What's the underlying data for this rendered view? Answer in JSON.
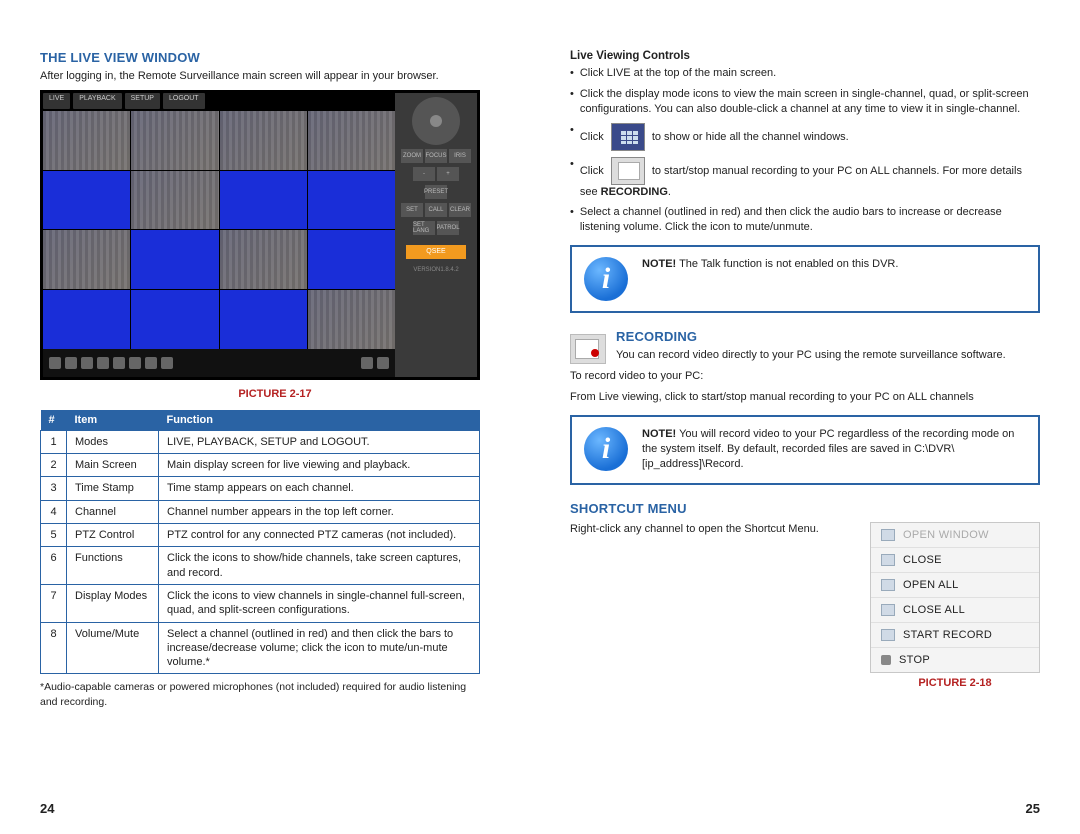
{
  "left": {
    "title": "THE LIVE VIEW WINDOW",
    "intro": "After logging in, the Remote Surveillance main screen will appear in your browser.",
    "picture_caption": "PICTURE 2-17",
    "table": {
      "headers": {
        "num": "#",
        "item": "Item",
        "func": "Function"
      },
      "rows": [
        {
          "num": "1",
          "item": "Modes",
          "func": "LIVE, PLAYBACK, SETUP and LOGOUT."
        },
        {
          "num": "2",
          "item": "Main Screen",
          "func": "Main display screen for live viewing and playback."
        },
        {
          "num": "3",
          "item": "Time Stamp",
          "func": "Time stamp appears on each channel."
        },
        {
          "num": "4",
          "item": "Channel",
          "func": "Channel number appears in the top left corner."
        },
        {
          "num": "5",
          "item": "PTZ Control",
          "func": "PTZ control for any connected PTZ cameras (not included)."
        },
        {
          "num": "6",
          "item": "Functions",
          "func": "Click the icons to show/hide channels, take screen captures, and record."
        },
        {
          "num": "7",
          "item": "Display Modes",
          "func": "Click the icons to view channels in single-channel full-screen, quad, and split-screen configurations."
        },
        {
          "num": "8",
          "item": "Volume/Mute",
          "func": "Select a channel (outlined in red) and then click the bars to increase/decrease volume; click the icon to mute/un-mute volume.*"
        }
      ]
    },
    "footnote": "*Audio-capable cameras or powered microphones (not included) required for audio listening and recording.",
    "page_num": "24",
    "lv": {
      "tabs": [
        "LIVE",
        "PLAYBACK",
        "SETUP",
        "LOGOUT"
      ],
      "logo": "QSEE",
      "version": "VERSION1.8.4.2"
    }
  },
  "right": {
    "controls_title": "Live Viewing Controls",
    "bullet1": "Click LIVE at the top of the main screen.",
    "bullet2": "Click the display mode icons to view the main screen in single-channel, quad, or split-screen configurations. You can also double-click a channel at any time to view it in single-channel.",
    "bullet3_pre": "Click",
    "bullet3_post": "to show or hide all the channel windows.",
    "bullet4_pre": "Click",
    "bullet4_post": "to start/stop manual recording to your PC on ALL channels. For more details see ",
    "bullet4_bold": "RECORDING",
    "bullet4_end": ".",
    "bullet5": "Select a channel (outlined in red) and then click the audio bars to increase or decrease listening volume. Click the icon to mute/unmute.",
    "note1_label": "NOTE!",
    "note1_text": " The Talk function is not enabled on this DVR.",
    "recording_title": "RECORDING",
    "recording_intro": "You can record video directly to your PC using the remote surveillance software.",
    "recording_step1": "To record video to your PC:",
    "recording_step2": "From Live viewing, click to start/stop manual recording to your PC on ALL channels",
    "note2_label": "NOTE!",
    "note2_text": " You will record video to your PC regardless of the recording mode on the system itself. By default, recorded files are saved in C:\\DVR\\[ip_address]\\Record.",
    "shortcut_title": "SHORTCUT MENU",
    "shortcut_text": "Right-click any channel to open the Shortcut Menu.",
    "shortcut_items": [
      "OPEN WINDOW",
      "CLOSE",
      "OPEN ALL",
      "CLOSE ALL",
      "START RECORD",
      "STOP"
    ],
    "picture_caption": "PICTURE 2-18",
    "page_num": "25"
  }
}
